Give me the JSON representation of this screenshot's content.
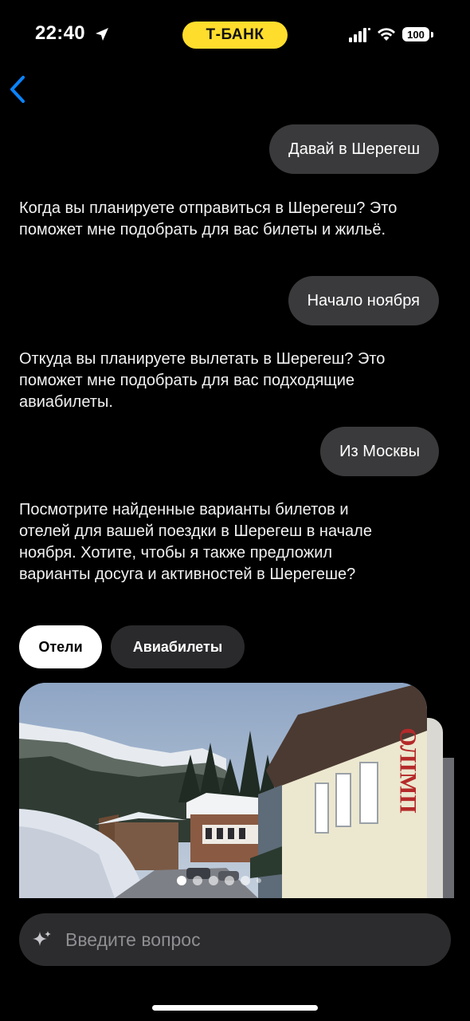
{
  "status_bar": {
    "time": "22:40",
    "brand": "Т-БАНК",
    "battery": "100",
    "icons": [
      "location-arrow-icon",
      "signal-icon",
      "wifi-icon",
      "battery-icon"
    ]
  },
  "nav": {
    "back_icon": "chevron-left-icon"
  },
  "messages": [
    {
      "role": "user",
      "text": "Давай в Шерегеш"
    },
    {
      "role": "bot",
      "text": "Когда вы планируете отправиться в Шерегеш? Это поможет мне подобрать для вас билеты и жильё."
    },
    {
      "role": "user",
      "text": "Начало ноября"
    },
    {
      "role": "bot",
      "text": "Откуда вы планируете вылетать в Шерегеш? Это поможет мне подобрать для вас подходящие авиабилеты."
    },
    {
      "role": "user",
      "text": "Из Москвы"
    },
    {
      "role": "bot",
      "text": "Посмотрите найденные варианты билетов и отелей для вашей поездки в Шерегеш в начале ноября. Хотите, чтобы я также предложил варианты досуга и активностей в Шерегеше?"
    }
  ],
  "tabs": [
    {
      "label": "Отели",
      "active": true
    },
    {
      "label": "Авиабилеты",
      "active": false
    }
  ],
  "carousel": {
    "active_index": 0,
    "sign_text": "ОЛІМП"
  },
  "input": {
    "placeholder": "Введите вопрос",
    "value": "",
    "icon": "sparkle-icon"
  },
  "colors": {
    "brand_yellow": "#ffdd2d",
    "back_blue": "#0a84ff",
    "bubble": "#3a3a3c"
  }
}
